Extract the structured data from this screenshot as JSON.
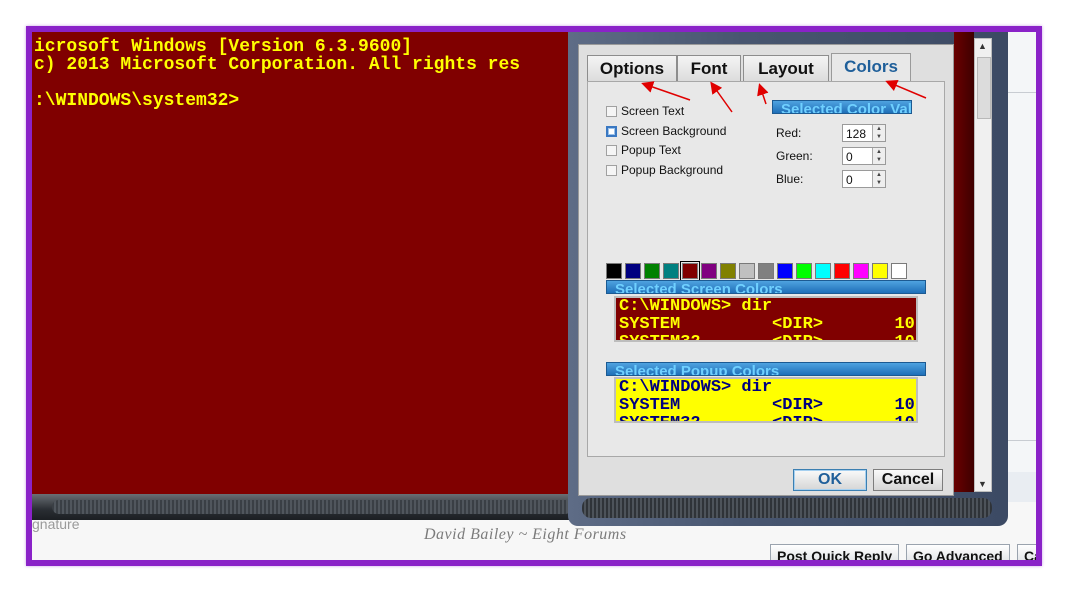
{
  "console": {
    "lines": [
      "icrosoft Windows [Version 6.3.9600]",
      "c) 2013 Microsoft Corporation. All rights res",
      "",
      ":\\WINDOWS\\system32>"
    ],
    "bg_color": "#800000",
    "text_color": "#ffff00"
  },
  "dialog": {
    "tabs": [
      {
        "label": "Options"
      },
      {
        "label": "Font"
      },
      {
        "label": "Layout"
      },
      {
        "label": "Colors",
        "active": true
      }
    ],
    "color_targets": [
      {
        "label": "Screen Text",
        "selected": false
      },
      {
        "label": "Screen Background",
        "selected": true
      },
      {
        "label": "Popup Text",
        "selected": false
      },
      {
        "label": "Popup Background",
        "selected": false
      }
    ],
    "selected_color_values_title": "Selected Color Val",
    "rgb": {
      "red_label": "Red:",
      "red_value": "128",
      "green_label": "Green:",
      "green_value": "0",
      "blue_label": "Blue:",
      "blue_value": "0"
    },
    "palette": [
      "#000000",
      "#000080",
      "#008000",
      "#008080",
      "#800000",
      "#800080",
      "#808000",
      "#c0c0c0",
      "#808080",
      "#0000ff",
      "#00ff00",
      "#00ffff",
      "#ff0000",
      "#ff00ff",
      "#ffff00",
      "#ffffff"
    ],
    "selected_screen_colors_title": "Selected Screen Colors",
    "screen_preview": {
      "lines": [
        "C:\\WINDOWS> dir",
        "SYSTEM         <DIR>       10",
        "SYSTEM32       <DIR>       10"
      ],
      "bg": "#800000",
      "fg": "#ffff00"
    },
    "selected_popup_colors_title": "Selected Popup Colors",
    "popup_preview": {
      "lines": [
        "C:\\WINDOWS> dir",
        "SYSTEM         <DIR>       10",
        "SYSTEM32       <DIR>       10"
      ],
      "bg": "#ffff00",
      "fg": "#000080"
    },
    "ok_label": "OK",
    "cancel_label": "Cancel"
  },
  "forum": {
    "signature_text": "gnature",
    "watermark": "David Bailey ~ Eight Forums",
    "post_quick_reply": "Post Quick Reply",
    "go_advanced": "Go Advanced",
    "cancel_partial": "Ca"
  },
  "colors": {
    "frame_purple": "#8a22c8",
    "annotation_red": "#e00000"
  }
}
